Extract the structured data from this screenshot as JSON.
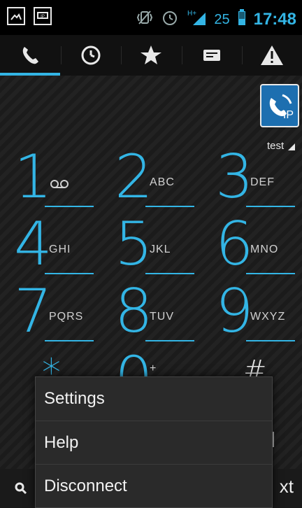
{
  "status_bar": {
    "battery_level": "25",
    "network": "H+",
    "time": "17:48"
  },
  "tabs": [
    {
      "name": "dialer",
      "icon": "phone-icon"
    },
    {
      "name": "call-log",
      "icon": "clock-icon"
    },
    {
      "name": "favorites",
      "icon": "star-icon"
    },
    {
      "name": "messages",
      "icon": "message-icon"
    },
    {
      "name": "alert",
      "icon": "warning-icon"
    }
  ],
  "ip_button": {
    "label": "IP"
  },
  "account": {
    "label": "test"
  },
  "dialpad": {
    "rows": [
      [
        {
          "digit": "1",
          "letters": ""
        },
        {
          "digit": "2",
          "letters": "ABC"
        },
        {
          "digit": "3",
          "letters": "DEF"
        }
      ],
      [
        {
          "digit": "4",
          "letters": "GHI"
        },
        {
          "digit": "5",
          "letters": "JKL"
        },
        {
          "digit": "6",
          "letters": "MNO"
        }
      ],
      [
        {
          "digit": "7",
          "letters": "PQRS"
        },
        {
          "digit": "8",
          "letters": "TUV"
        },
        {
          "digit": "9",
          "letters": "WXYZ"
        }
      ],
      [
        {
          "digit": "*",
          "letters": ""
        },
        {
          "digit": "0",
          "letters": "+"
        },
        {
          "digit": "#",
          "letters": ""
        }
      ]
    ]
  },
  "menu": {
    "items": [
      "Settings",
      "Help",
      "Disconnect"
    ]
  },
  "bottom": {
    "right_text": "xt"
  },
  "colors": {
    "accent": "#33b5e5",
    "ip_bg": "#1d6fb0"
  }
}
